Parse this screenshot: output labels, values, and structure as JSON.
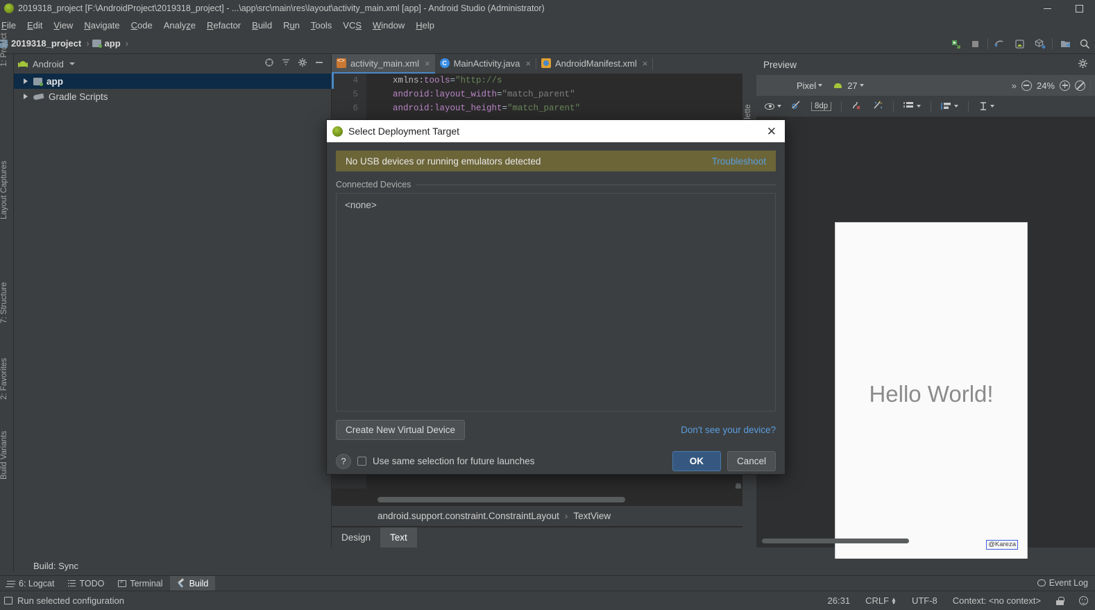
{
  "window": {
    "title": "2019318_project [F:\\AndroidProject\\2019318_project] - ...\\app\\src\\main\\res\\layout\\activity_main.xml [app] - Android Studio (Administrator)",
    "minimize_label": "minimize",
    "restore_label": "restore"
  },
  "menubar": {
    "items": [
      {
        "label": "File"
      },
      {
        "label": "Edit"
      },
      {
        "label": "View"
      },
      {
        "label": "Navigate"
      },
      {
        "label": "Code"
      },
      {
        "label": "Analyze"
      },
      {
        "label": "Refactor"
      },
      {
        "label": "Build"
      },
      {
        "label": "Run"
      },
      {
        "label": "Tools"
      },
      {
        "label": "VCS"
      },
      {
        "label": "Window"
      },
      {
        "label": "Help"
      }
    ]
  },
  "toolbar": {
    "breadcrumb": [
      {
        "label": "2019318_project"
      },
      {
        "label": "app"
      }
    ],
    "separator": "›",
    "icons": [
      "run-icon",
      "stop-icon",
      "sync-gradle-icon",
      "avd-manager-icon",
      "sdk-manager-icon",
      "project-structure-icon",
      "search-icon"
    ]
  },
  "left_strip": {
    "labels": [
      "1: Project",
      "Layout Captures",
      "7: Structure",
      "2: Favorites",
      "Build Variants"
    ]
  },
  "project_panel": {
    "title": "Android",
    "header_icons": [
      "target-icon",
      "collapse-all-icon",
      "gear-icon",
      "hide-icon"
    ],
    "tree": [
      {
        "label": "app",
        "selected": true
      },
      {
        "label": "Gradle Scripts",
        "selected": false
      }
    ]
  },
  "editor": {
    "tabs": [
      {
        "label": "activity_main.xml",
        "icon": "xml-layout-icon",
        "active": true,
        "close": "×"
      },
      {
        "label": "MainActivity.java",
        "icon": "java-class-icon",
        "active": false,
        "close": "×"
      },
      {
        "label": "AndroidManifest.xml",
        "icon": "manifest-icon",
        "active": false,
        "close": "×"
      }
    ],
    "code_lines": [
      {
        "num": "4",
        "attr": "xmlns:tools",
        "ns": "",
        "value": "\"http://s"
      },
      {
        "num": "5",
        "attr": "android:layout_width",
        "ns": "",
        "value": "\"match_parent\""
      },
      {
        "num": "6",
        "attr": "android:layout_height",
        "ns": "",
        "value": "\"match_parent\""
      }
    ],
    "component_tree": {
      "root": "android.support.constraint.ConstraintLayout",
      "separator": "›",
      "child": "TextView"
    },
    "design_tabs": [
      {
        "label": "Design",
        "active": false
      },
      {
        "label": "Text",
        "active": true
      }
    ],
    "palette_label": "Palette"
  },
  "preview": {
    "title": "Preview",
    "gear_icon": "gear-icon",
    "device": "Pixel",
    "api_level": "27",
    "api_icon": "android-icon",
    "overflow": "»",
    "zoom_out_icon": "zoom-out-icon",
    "zoom_level": "24%",
    "zoom_in_icon": "zoom-in-icon",
    "zoom_fit_icon": "zoom-fit-icon",
    "tools": [
      {
        "name": "eye-icon",
        "label": ""
      },
      {
        "name": "constraints-off-icon",
        "label": ""
      },
      {
        "name": "margin-value",
        "label": "8dp"
      },
      {
        "name": "clear-constraints-icon",
        "label": ""
      },
      {
        "name": "infer-constraints-icon",
        "label": ""
      },
      {
        "name": "guidelines-icon",
        "label": ""
      },
      {
        "name": "align-icon",
        "label": ""
      },
      {
        "name": "baseline-icon",
        "label": ""
      }
    ],
    "render": {
      "hello_text": "Hello World!",
      "selected_widget_text": "@Kareza",
      "selection_color": "#3b5bdb"
    }
  },
  "dialog": {
    "title": "Select Deployment Target",
    "icon": "android-icon",
    "close": "✕",
    "warning": {
      "text": "No USB devices or running emulators detected",
      "link": "Troubleshoot",
      "bg_color": "#6c6538",
      "link_color": "#599ee0"
    },
    "section_label": "Connected Devices",
    "device_list": [
      "<none>"
    ],
    "create_device_button": "Create New Virtual Device",
    "dont_see_link": "Don't see your device?",
    "help_button": "?",
    "checkbox_label": "Use same selection for future launches",
    "checkbox_checked": false,
    "ok_button": "OK",
    "cancel_button": "Cancel",
    "ok_color": "#365880"
  },
  "bottom": {
    "build_title": "Build: Sync",
    "tabs": [
      {
        "label": "6: Logcat",
        "icon": "logcat-icon",
        "active": false
      },
      {
        "label": "TODO",
        "icon": "todo-icon",
        "active": false
      },
      {
        "label": "Terminal",
        "icon": "terminal-icon",
        "active": false
      },
      {
        "label": "Build",
        "icon": "hammer-icon",
        "active": true
      }
    ],
    "event_log": "Event Log"
  },
  "status": {
    "message": "Run selected configuration",
    "caret_position": "26:31",
    "line_separator": "CRLF",
    "encoding": "UTF-8",
    "context": "Context: <no context>",
    "lock_icon": "lock-icon",
    "feedback_icon": "smiley-icon"
  }
}
